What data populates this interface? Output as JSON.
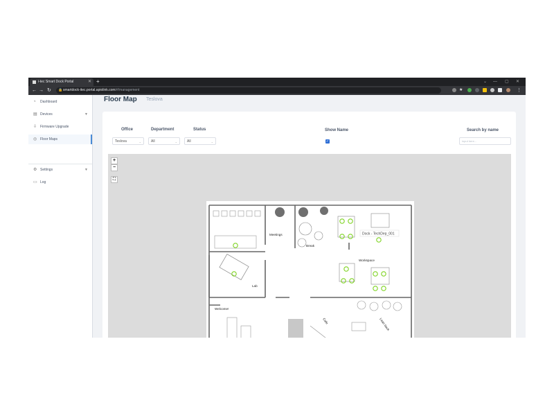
{
  "browser": {
    "tab_title": "i-tec Smart Dock Portal",
    "url_host": "smartdock-itec.portal.apiolink.com",
    "url_path": "/#/management"
  },
  "sidebar": {
    "items": [
      {
        "label": "Dashboard",
        "icon": "dashboard-icon"
      },
      {
        "label": "Devices",
        "icon": "devices-icon"
      },
      {
        "label": "Firmware Upgrade",
        "icon": "upgrade-icon"
      },
      {
        "label": "Floor Maps",
        "icon": "pin-icon"
      },
      {
        "label": "Settings",
        "icon": "gear-icon"
      },
      {
        "label": "Log",
        "icon": "log-icon"
      }
    ]
  },
  "page": {
    "title": "Floor Map",
    "subtitle": "Teslova"
  },
  "filters": {
    "office_label": "Office",
    "office_value": "Teslova",
    "department_label": "Department",
    "department_value": "All",
    "status_label": "Status",
    "status_value": "All",
    "show_name_label": "Show Name",
    "show_name_checked": true,
    "search_label": "Search by name",
    "search_placeholder": "input here..."
  },
  "map": {
    "zoom_in": "+",
    "zoom_out": "−",
    "fullscreen_icon": "fullscreen-icon",
    "rooms": {
      "meetings": "Meetings",
      "break": "Break",
      "workspace": "Workspace",
      "lab": "Lab",
      "welcome": "Welcome!",
      "lean_back": "Lean back",
      "cafe": "Cafe"
    },
    "dock_tooltip": "Dock - TechDep_001",
    "dock_color": "#7ed321"
  },
  "colors": {
    "accent": "#4a8bd6",
    "title": "#2c3e50"
  }
}
